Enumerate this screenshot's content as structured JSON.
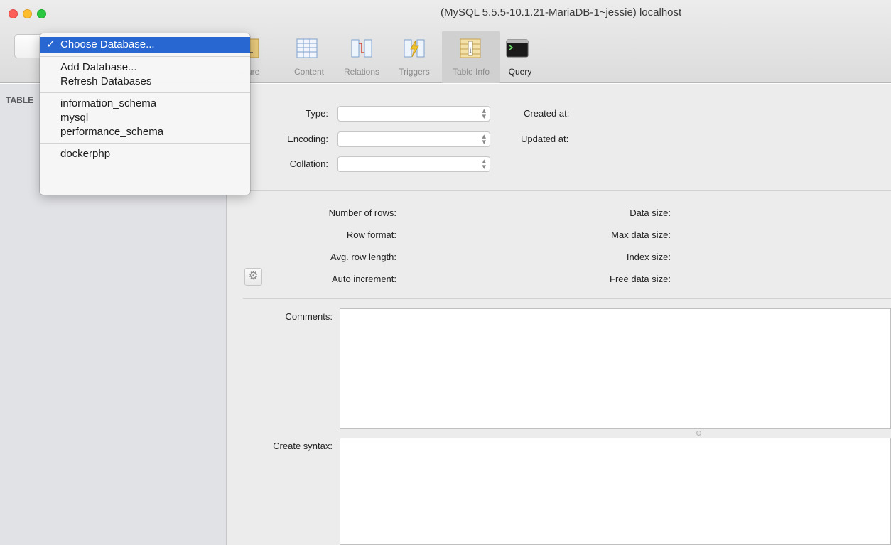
{
  "window": {
    "title": "(MySQL 5.5.5-10.1.21-MariaDB-1~jessie) localhost"
  },
  "toolbar": {
    "items": [
      {
        "label": "Structure",
        "visible_label": "ucture",
        "icon": "structure-icon"
      },
      {
        "label": "Content",
        "icon": "content-table-icon"
      },
      {
        "label": "Relations",
        "icon": "relations-icon"
      },
      {
        "label": "Triggers",
        "icon": "triggers-icon"
      },
      {
        "label": "Table Info",
        "icon": "table-info-icon",
        "selected": true
      },
      {
        "label": "Query",
        "icon": "terminal-icon"
      }
    ]
  },
  "database_menu": {
    "selected": "Choose Database...",
    "check": "✓",
    "items": {
      "choose": "Choose Database...",
      "add": "Add Database...",
      "refresh": "Refresh Databases",
      "db1": "information_schema",
      "db2": "mysql",
      "db3": "performance_schema",
      "db4": "dockerphp"
    }
  },
  "sidebar": {
    "header": "TABLE"
  },
  "table_info": {
    "type_label": "Type:",
    "encoding_label": "Encoding:",
    "collation_label": "Collation:",
    "created_label": "Created at:",
    "updated_label": "Updated at:",
    "rows_label": "Number of rows:",
    "row_format_label": "Row format:",
    "avg_row_label": "Avg. row length:",
    "auto_inc_label": "Auto increment:",
    "data_size_label": "Data size:",
    "max_data_label": "Max data size:",
    "index_size_label": "Index size:",
    "free_data_label": "Free data size:",
    "comments_label": "Comments:",
    "create_syntax_label": "Create syntax:"
  },
  "colors": {
    "menu_highlight": "#2866d1",
    "sidebar_bg": "#e1e2e6",
    "main_bg": "#ececec"
  }
}
